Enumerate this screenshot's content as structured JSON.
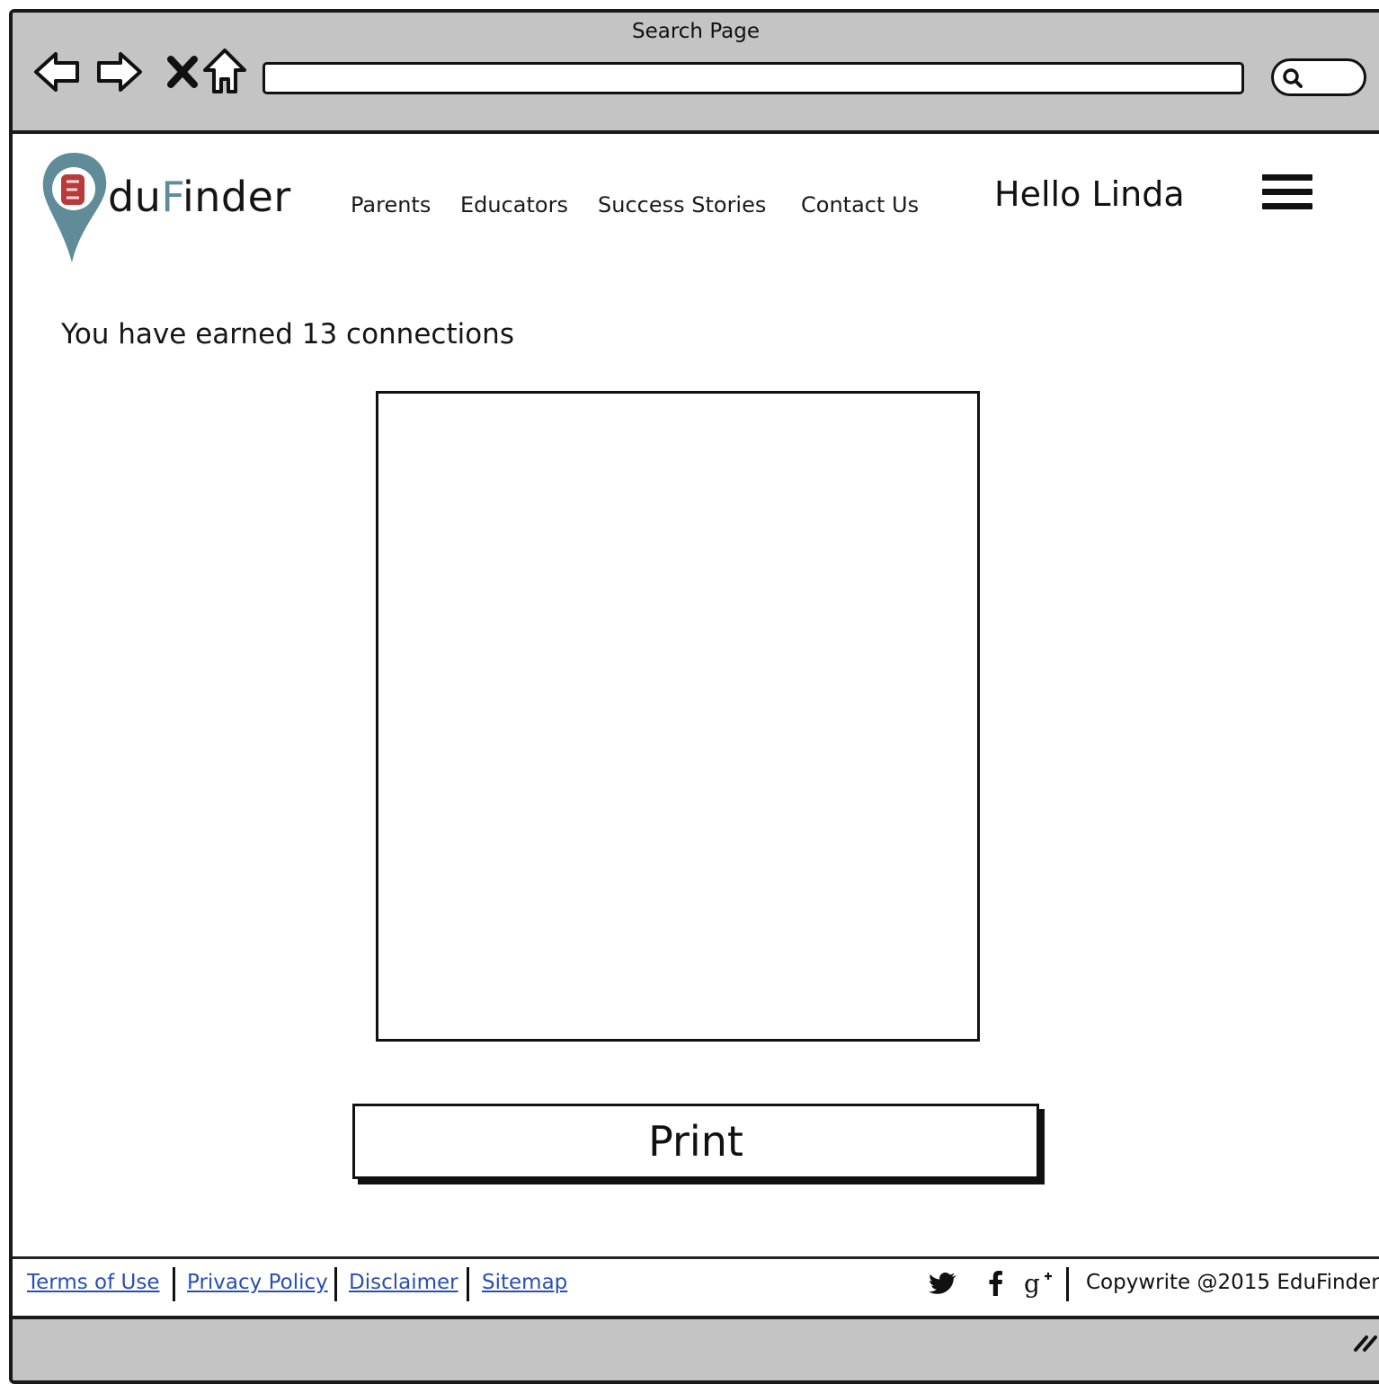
{
  "window": {
    "title": "Search Page"
  },
  "header": {
    "logo_prefix": "du",
    "logo_f": "F",
    "logo_suffix": "inder",
    "nav": [
      "Parents",
      "Educators",
      "Success Stories",
      "Contact Us"
    ],
    "greeting": "Hello Linda"
  },
  "main": {
    "earned_text": "You have earned 13 connections",
    "print_label": "Print"
  },
  "footer": {
    "links": [
      "Terms of Use",
      "Privacy Policy",
      "Disclaimer",
      "Sitemap"
    ],
    "copyright": "Copywrite @2015 EduFinder"
  },
  "colors": {
    "chrome": "#c4c4c4",
    "logo_accent": "#5f8c98",
    "logo_e": "#b83a3a",
    "link": "#2a4fb0"
  },
  "icons": [
    "back-arrow-icon",
    "forward-arrow-icon",
    "close-icon",
    "home-icon",
    "search-icon",
    "map-pin-icon",
    "hamburger-menu-icon",
    "twitter-icon",
    "facebook-icon",
    "google-plus-icon",
    "resize-grip-icon"
  ]
}
